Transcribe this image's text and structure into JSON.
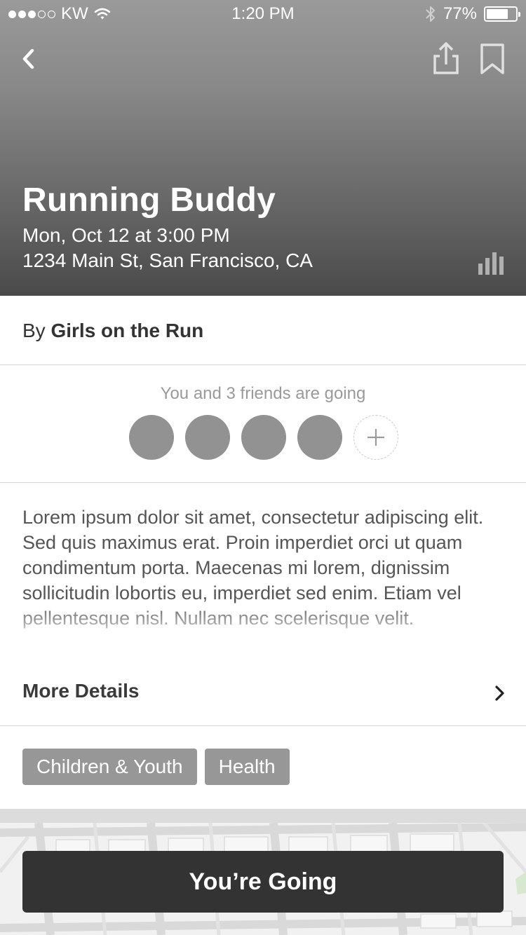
{
  "status_bar": {
    "carrier": "KW",
    "time": "1:20 PM",
    "battery_percent": "77%",
    "battery_level": 0.77,
    "signal_bars_filled": 3,
    "signal_bars_total": 5
  },
  "header": {
    "title": "Running Buddy",
    "date": "Mon, Oct 12 at 3:00 PM",
    "address": "1234 Main St, San Francisco, CA",
    "back_icon": "chevron-left-icon",
    "share_icon": "share-icon",
    "bookmark_icon": "bookmark-icon",
    "stats_icon": "bar-chart-icon"
  },
  "organizer": {
    "prefix": "By",
    "name": "Girls on the Run"
  },
  "friends": {
    "text": "You and 3 friends are going",
    "avatar_count": 4,
    "add_icon": "plus-icon"
  },
  "description": {
    "text": "Lorem ipsum dolor sit amet, consectetur adipiscing elit. Sed quis maximus erat. Proin imperdiet orci ut quam condimentum porta. Maecenas mi lorem, dignissim sollicitudin lobortis eu, imperdiet sed enim. Etiam vel pellentesque nisl. Nullam nec scelerisque velit."
  },
  "more_details": {
    "label": "More Details",
    "icon": "chevron-right-icon"
  },
  "tags": [
    "Children & Youth",
    "Health"
  ],
  "cta": {
    "label": "You’re Going"
  },
  "colors": {
    "header_top": "#9a9a9a",
    "header_bottom": "#4a4a4a",
    "avatar": "#929292",
    "tag": "#979797",
    "cta_bg": "#333333"
  }
}
